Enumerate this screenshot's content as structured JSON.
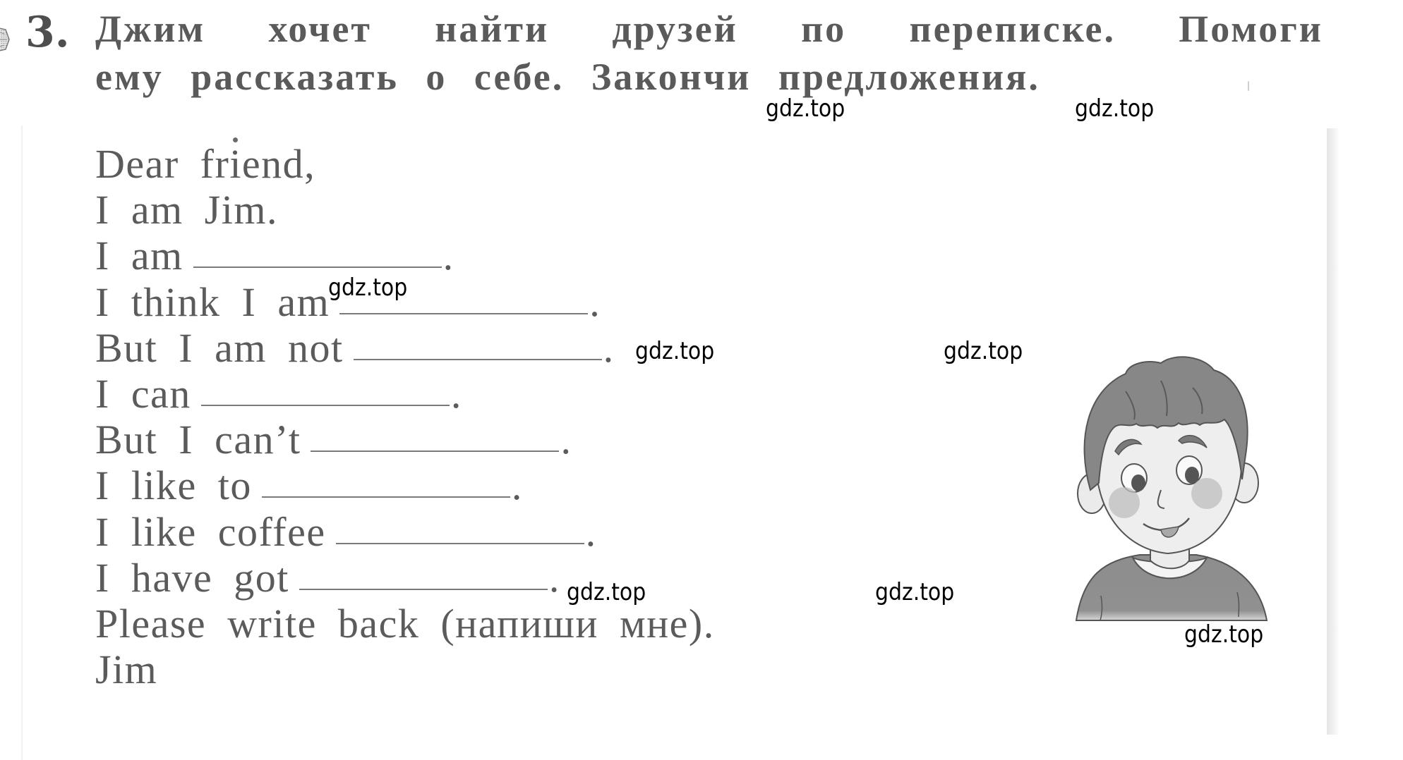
{
  "exercise": {
    "number": "3.",
    "marker_icon": "exercise-marker-icon",
    "instruction_line1_words": [
      "Джим",
      "хочет",
      "найти",
      "друзей",
      "по",
      "переписке.",
      "Помоги"
    ],
    "instruction_line2": "ему рассказать о себе. Закончи предложения."
  },
  "letter": {
    "lines": [
      {
        "text": "Dear friend,",
        "has_blank": false
      },
      {
        "text": "I am Jim.",
        "has_blank": false
      },
      {
        "text": "I am",
        "has_blank": true
      },
      {
        "text": "I think I am",
        "has_blank": true
      },
      {
        "text": "But I am not",
        "has_blank": true
      },
      {
        "text": "I can",
        "has_blank": true
      },
      {
        "text": "But I can’t",
        "has_blank": true
      },
      {
        "text": "I like to",
        "has_blank": true
      },
      {
        "text": "I like coffee",
        "has_blank": true
      },
      {
        "text": "I have got",
        "has_blank": true
      },
      {
        "text": "Please write back (напиши мне).",
        "has_blank": false
      },
      {
        "text": "Jim",
        "has_blank": false
      }
    ],
    "blank_period": ".",
    "blank_values": [
      "",
      "",
      "",
      "",
      "",
      "",
      "",
      ""
    ]
  },
  "illustration": {
    "subject": "boy-portrait"
  },
  "watermarks": [
    "gdz.top",
    "gdz.top",
    "gdz.top",
    "gdz.top",
    "gdz.top",
    "gdz.top",
    "gdz.top",
    "gdz.top"
  ],
  "colors": {
    "text": "#5b5b5b",
    "watermark": "#000000",
    "blank_line": "#7a7a7a"
  }
}
